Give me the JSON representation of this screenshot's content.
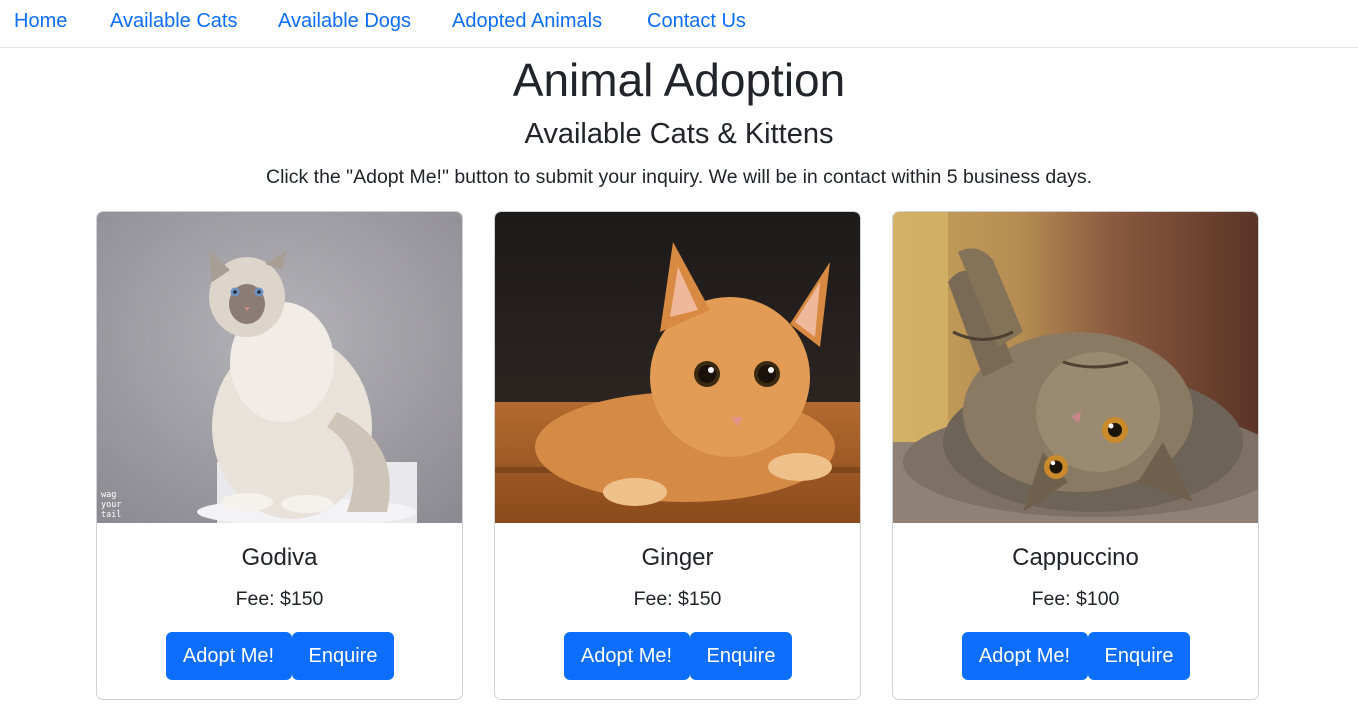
{
  "nav": {
    "items": [
      "Home",
      "Available Cats",
      "Available Dogs",
      "Adopted Animals",
      "Contact Us"
    ]
  },
  "header": {
    "title": "Animal Adoption",
    "subtitle": "Available Cats & Kittens",
    "intro": "Click the \"Adopt Me!\" button to submit your inquiry. We will be in contact within 5 business days."
  },
  "cards": [
    {
      "name": "Godiva",
      "fee": "Fee: $150",
      "adopt_label": "Adopt Me!",
      "enquire_label": "Enquire",
      "watermark": "wag your tail"
    },
    {
      "name": "Ginger",
      "fee": "Fee: $150",
      "adopt_label": "Adopt Me!",
      "enquire_label": "Enquire"
    },
    {
      "name": "Cappuccino",
      "fee": "Fee: $100",
      "adopt_label": "Adopt Me!",
      "enquire_label": "Enquire"
    }
  ],
  "colors": {
    "accent": "#0d6efd",
    "text": "#212529",
    "border": "#dee2e6"
  }
}
